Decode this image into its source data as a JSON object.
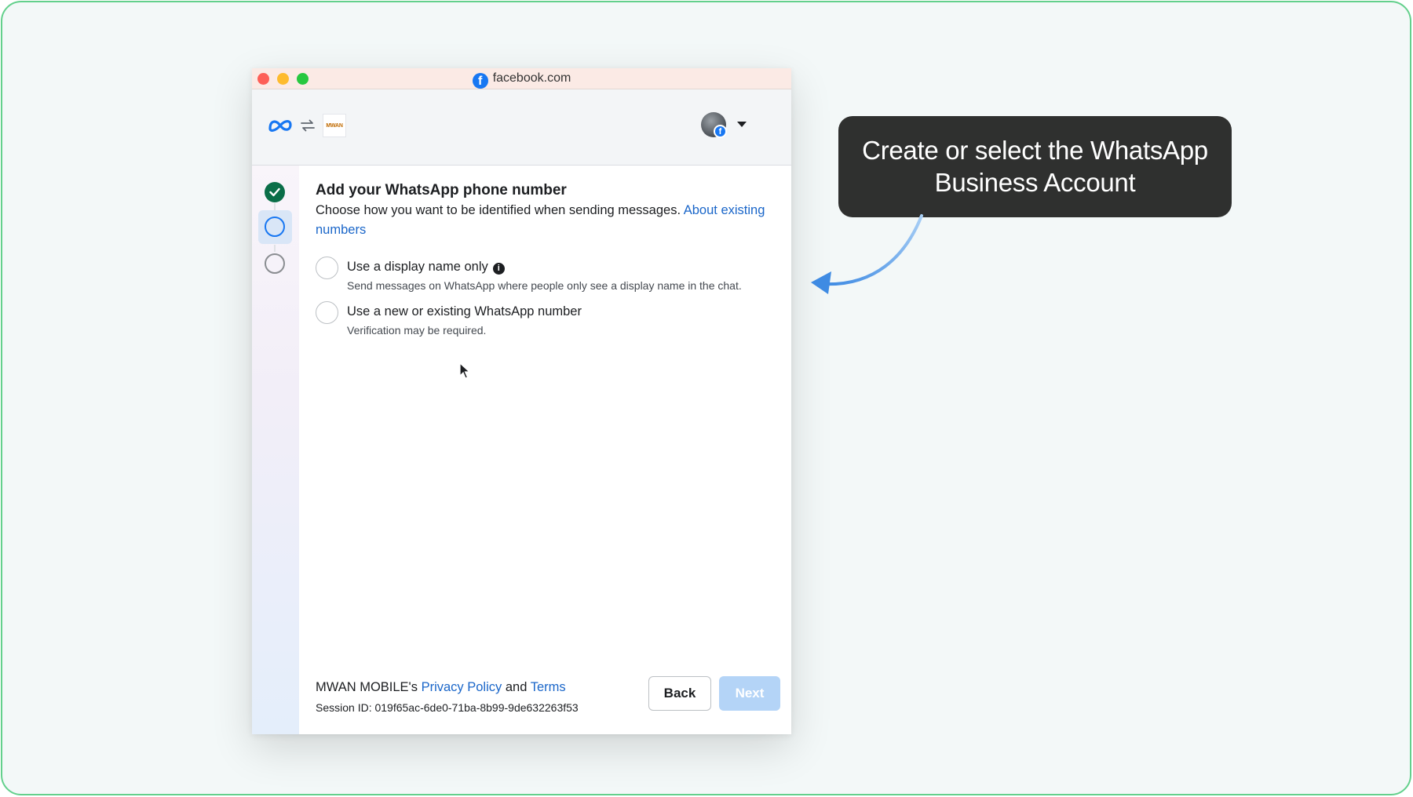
{
  "window": {
    "url": "facebook.com"
  },
  "header": {
    "business_logo_text": "MWAN"
  },
  "main": {
    "title": "Add your WhatsApp phone number",
    "subtitle": "Choose how you want to be identified when sending messages.",
    "about_link": "About existing numbers",
    "options": [
      {
        "label": "Use a display name only",
        "description": "Send messages on WhatsApp where people only see a display name in the chat."
      },
      {
        "label": "Use a new or existing WhatsApp number",
        "description": "Verification may be required."
      }
    ]
  },
  "footer": {
    "owner": "MWAN MOBILE's",
    "privacy_link": "Privacy Policy",
    "and_text": "and",
    "terms_link": "Terms",
    "session": "Session ID: 019f65ac-6de0-71ba-8b99-9de632263f53",
    "back_label": "Back",
    "next_label": "Next"
  },
  "callout": {
    "text": "Create or select the WhatsApp Business Account"
  },
  "colors": {
    "accent": "#1877f2",
    "link": "#1a66c9",
    "step_done": "#0a6e48",
    "frame_border": "#63d08c",
    "callout_bg": "#2f302f",
    "arrow": "#4a93e6"
  }
}
